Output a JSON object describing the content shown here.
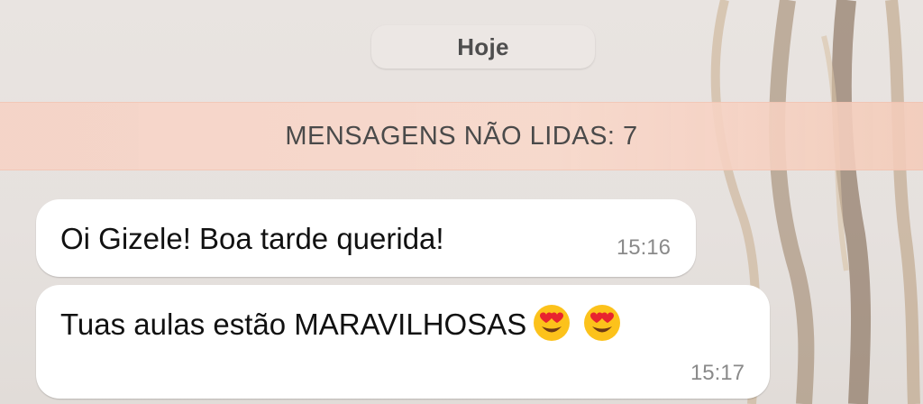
{
  "chat": {
    "date_label": "Hoje",
    "unread_banner": "MENSAGENS NÃO LIDAS: 7",
    "messages": [
      {
        "text": "Oi Gizele! Boa tarde querida!",
        "time": "15:16"
      },
      {
        "text": "Tuas aulas estão MARAVILHOSAS",
        "emojis": [
          "heart-eyes-emoji",
          "heart-eyes-emoji"
        ],
        "time": "15:17"
      }
    ]
  },
  "colors": {
    "background": "#e6e1de",
    "bubble": "#ffffff",
    "unread_banner": "#f7d5c8",
    "timestamp": "#8a8a8a",
    "text": "#111111"
  }
}
